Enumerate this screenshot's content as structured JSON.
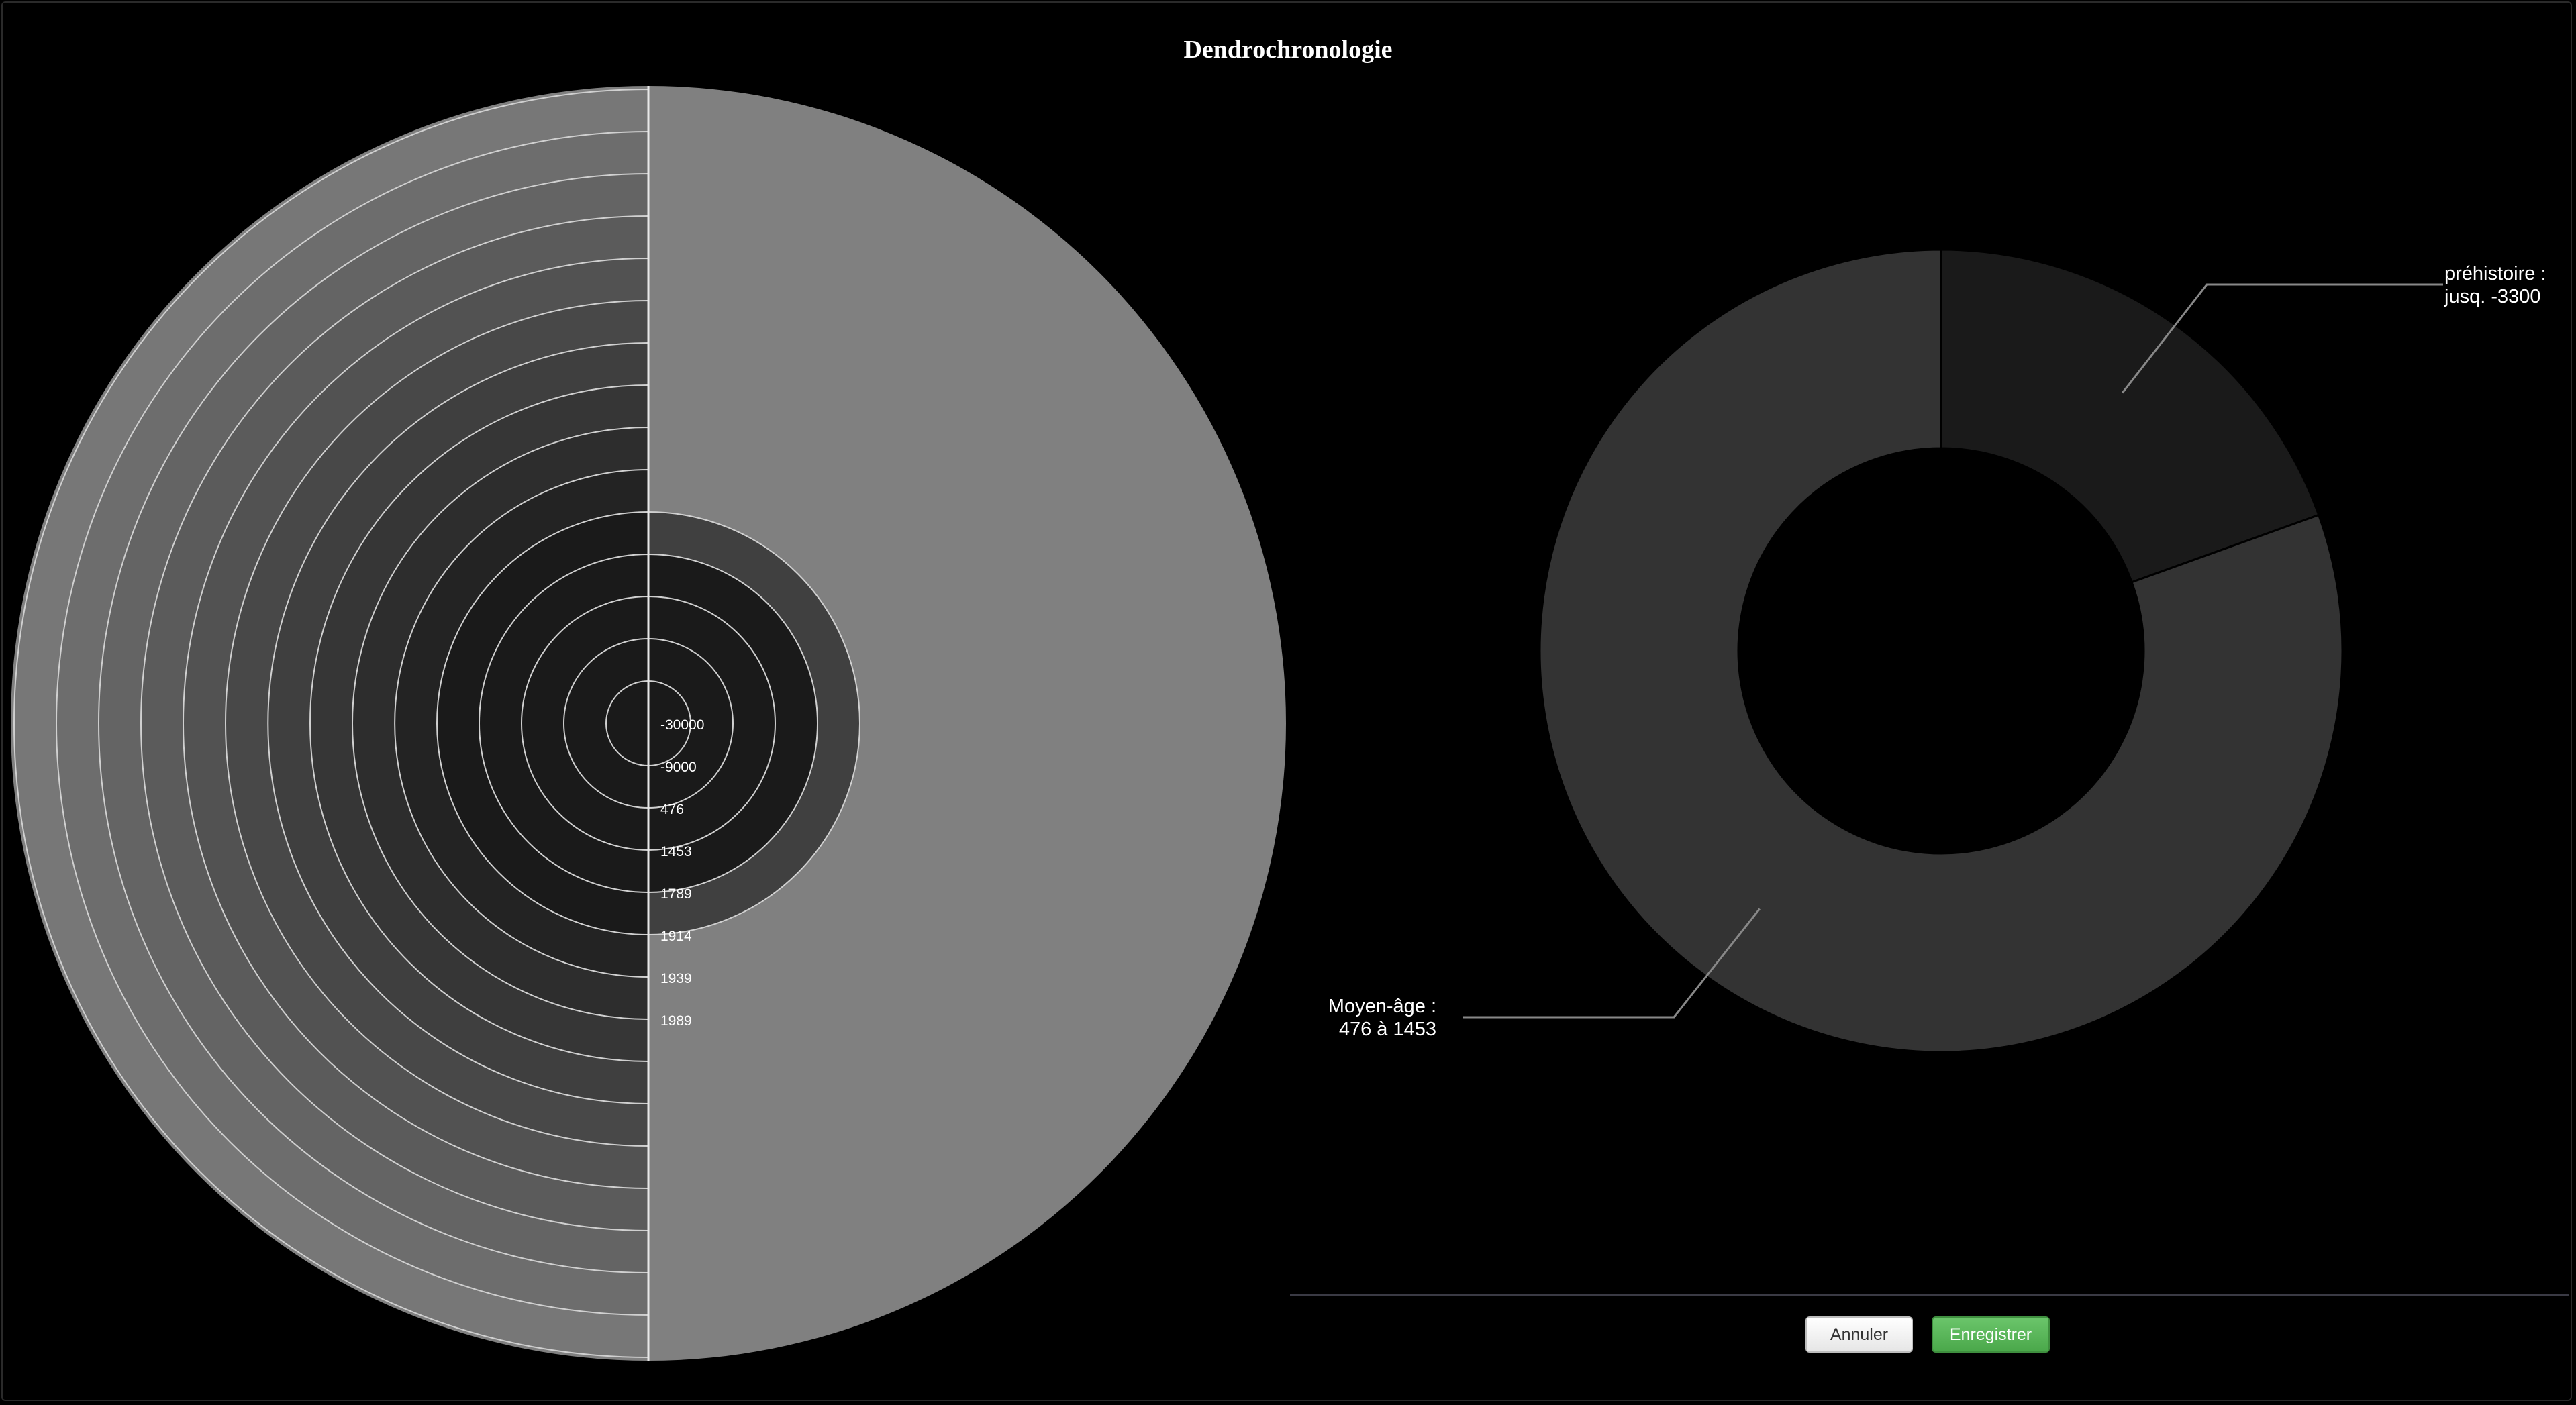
{
  "title": "Dendrochronologie",
  "buttons": {
    "cancel_label": "Annuler",
    "save_label": "Enregistrer",
    "save_color": "#5cb85c"
  },
  "chart_data": [
    {
      "type": "pie",
      "subtype": "concentric-rings",
      "ring_labels": [
        "-30000",
        "-9000",
        "476",
        "1453",
        "1789",
        "1914",
        "1939",
        "1989"
      ],
      "left_half_ring_count": 15,
      "right_half_fills": [
        {
          "up_to": "1453",
          "color": "#1a1a1a"
        },
        {
          "up_to": "1789",
          "color": "#404040"
        },
        {
          "up_to": "outer",
          "color": "#808080"
        }
      ],
      "left_half_colors": {
        "inner": "#1a1a1a",
        "outer": "#808080"
      },
      "ring_stroke": "#d0d0d0"
    },
    {
      "type": "pie",
      "subtype": "donut",
      "slices": [
        {
          "label_line1": "préhistoire :",
          "label_line2": "jusq. -3300",
          "value": 19.5,
          "color": "#1a1a1a"
        },
        {
          "label_line1": "Moyen-âge :",
          "label_line2": "476 à 1453",
          "value": 80.5,
          "color": "#333333"
        }
      ],
      "start_angle_deg": 0,
      "leader_color": "#888888"
    }
  ]
}
